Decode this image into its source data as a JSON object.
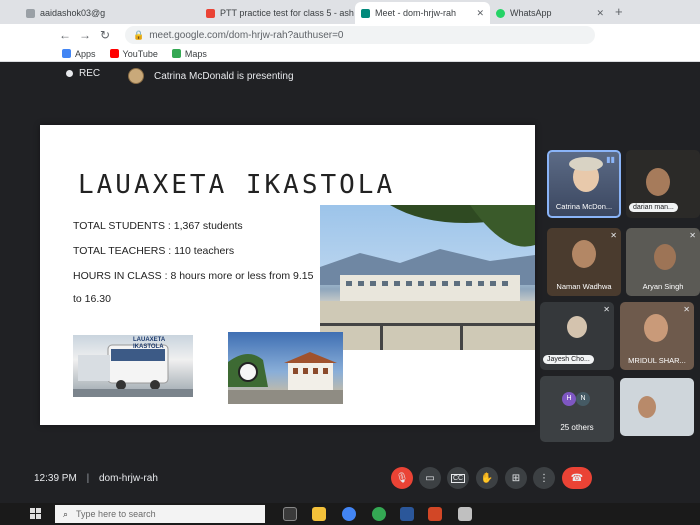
{
  "browser": {
    "tabs": [
      {
        "label": "aaidashok03@g",
        "active": false
      },
      {
        "label": "PTT practice test for class 5 - ash",
        "active": false
      },
      {
        "label": "Meet - dom-hrjw-rah",
        "active": true
      },
      {
        "label": "WhatsApp",
        "active": false
      }
    ],
    "url": "meet.google.com/dom-hrjw-rah?authuser=0",
    "bookmarks": [
      "Apps",
      "YouTube",
      "Maps"
    ]
  },
  "meet": {
    "rec_label": "REC",
    "presenting_text": "Catrina McDonald is presenting",
    "time": "12:39 PM",
    "separator": "|",
    "meeting_code": "dom-hrjw-rah"
  },
  "slide": {
    "title": "LAUAXETA IKASTOLA",
    "lines": [
      "TOTAL STUDENTS : 1,367 students",
      "TOTAL TEACHERS : 110 teachers",
      "HOURS IN CLASS : 8 hours more or less from 9.15",
      "to 16.30"
    ],
    "bus_sign": "LAUAXETA IKASTOLA"
  },
  "participants": [
    {
      "name": "Catrina McDon..."
    },
    {
      "name": "darian man..."
    },
    {
      "name": "Naman Wadhwa"
    },
    {
      "name": "Aryan Singh"
    },
    {
      "name": "Jayesh Cho..."
    },
    {
      "name": "MRIDUL SHAR..."
    },
    {
      "name": "25 others",
      "initials": [
        "H",
        "N"
      ]
    }
  ],
  "taskbar": {
    "search_placeholder": "Type here to search"
  },
  "colors": {
    "meet_bg": "#202124",
    "end_call": "#ea4335",
    "mic_muted": "#ea4335",
    "active_speaker": "#8ab4f8"
  }
}
